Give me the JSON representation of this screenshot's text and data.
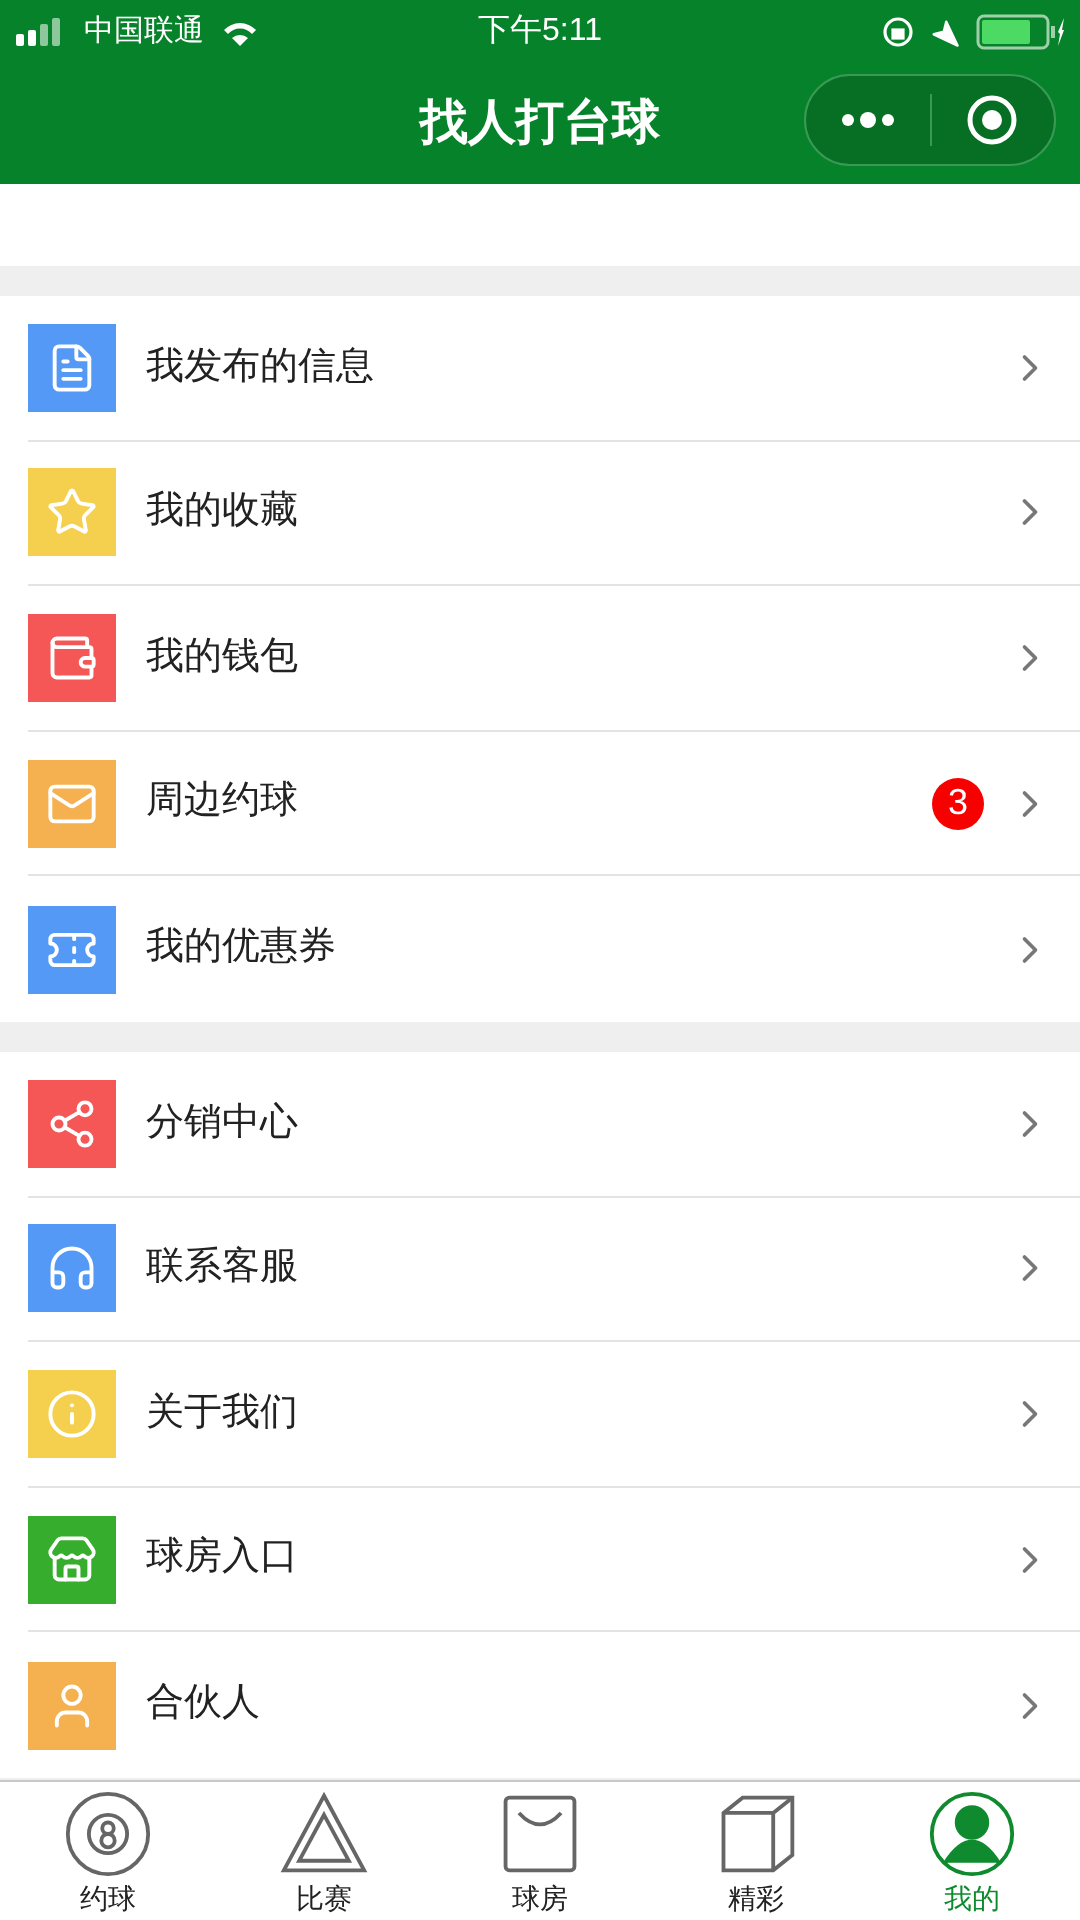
{
  "status_bar": {
    "carrier": "中国联通",
    "time": "下午5:11"
  },
  "title": "找人打台球",
  "sections": [
    {
      "items": [
        {
          "label": "我发布的信息",
          "color": "#5399f5"
        },
        {
          "label": "我的收藏",
          "color": "#f5d04f"
        },
        {
          "label": "我的钱包",
          "color": "#f55656"
        },
        {
          "label": "周边约球",
          "color": "#f5b04f",
          "badge": "3"
        },
        {
          "label": "我的优惠券",
          "color": "#5399f5"
        }
      ]
    },
    {
      "items": [
        {
          "label": "分销中心",
          "color": "#f55656"
        },
        {
          "label": "联系客服",
          "color": "#5399f5"
        },
        {
          "label": "关于我们",
          "color": "#f5d04f"
        },
        {
          "label": "球房入口",
          "color": "#36ad2c"
        },
        {
          "label": "合伙人",
          "color": "#f5b04f"
        }
      ]
    }
  ],
  "tabs": [
    {
      "label": "约球",
      "selected": false
    },
    {
      "label": "比赛",
      "selected": false
    },
    {
      "label": "球房",
      "selected": false
    },
    {
      "label": "精彩",
      "selected": false
    },
    {
      "label": "我的",
      "selected": true
    }
  ]
}
